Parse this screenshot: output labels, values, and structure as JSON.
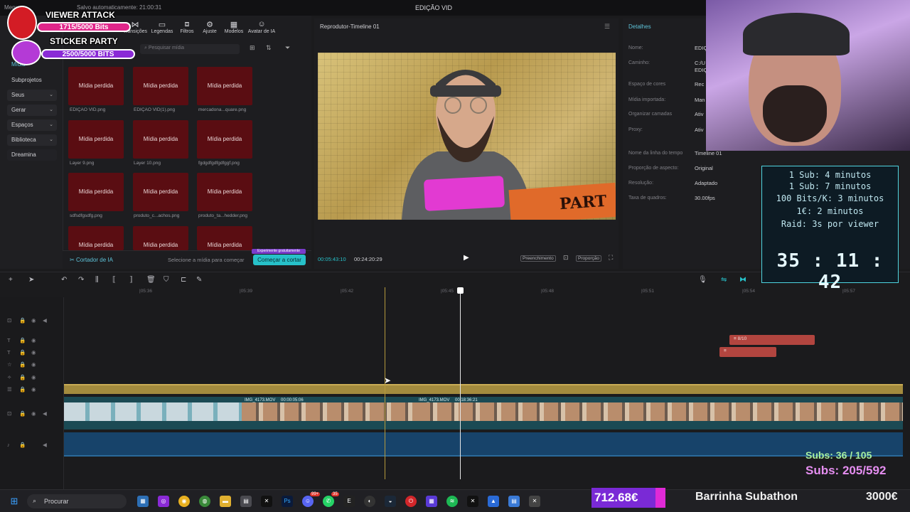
{
  "app": {
    "menu_label": "Menu",
    "autosave": "Salvo automaticamente: 21:00:31",
    "window_title": "EDIÇÃO VID"
  },
  "toolbar": {
    "items": [
      {
        "label": "Transições",
        "icon": "transition-icon"
      },
      {
        "label": "Legendas",
        "icon": "captions-icon"
      },
      {
        "label": "Filtros",
        "icon": "filters-icon"
      },
      {
        "label": "Ajuste",
        "icon": "adjust-icon"
      },
      {
        "label": "Modelos",
        "icon": "templates-icon"
      },
      {
        "label": "Avatar de IA",
        "icon": "avatar-icon"
      }
    ]
  },
  "leftnav": {
    "active": "Mídia",
    "items": [
      "Subprojetos",
      "Seus",
      "Gerar",
      "Espaços",
      "Biblioteca",
      "Dreamina"
    ]
  },
  "media": {
    "search_placeholder": "Pesquisar mídia",
    "items": [
      {
        "label": "Mídia perdida",
        "caption": "EDIÇÃO VID.png"
      },
      {
        "label": "Mídia perdida",
        "caption": "EDIÇÃO VID(1).png"
      },
      {
        "label": "Mídia perdida",
        "caption": "mercadona...quare.png"
      },
      {
        "label": "Mídia perdida",
        "caption": "Layer 9.png"
      },
      {
        "label": "Mídia perdida",
        "caption": "Layer 10.png"
      },
      {
        "label": "Mídia perdida",
        "caption": "fgdgdfgdfgdfggf.png"
      },
      {
        "label": "Mídia perdida",
        "caption": "sdfsdfgsdfg.png"
      },
      {
        "label": "Mídia perdida",
        "caption": "produto_c...achos.png"
      },
      {
        "label": "Mídia perdida",
        "caption": "produto_ta...hedder.png"
      },
      {
        "label": "Mídia perdida",
        "caption": ""
      },
      {
        "label": "Mídia perdida",
        "caption": ""
      },
      {
        "label": "Mídia perdida",
        "caption": ""
      }
    ],
    "footer": {
      "ai_cutter": "Cortador de IA",
      "hint": "Selecione a mídia para começar",
      "trial": "Experimente gratuitamente",
      "button": "Começar a cortar"
    }
  },
  "player": {
    "title": "Reprodutor-Timeline 01",
    "current": "00:05:43:10",
    "total": "00:24:20:29",
    "fill_label": "Preenchimento",
    "ratio_label": "Proporção"
  },
  "details": {
    "title": "Detalhes",
    "rows": [
      {
        "label": "Nome:",
        "value": "EDIÇ"
      },
      {
        "label": "Caminho:",
        "value": "C:/U"
      },
      {
        "label": "",
        "value": "EDIÇ"
      },
      {
        "label": "Espaço de cores",
        "value": "Rec"
      },
      {
        "label": "Mídia importada:",
        "value": "Man"
      },
      {
        "label": "Organizar camadas",
        "value": "Ativ"
      },
      {
        "label": "Proxy:",
        "value": "Ativ"
      },
      {
        "label": "Nome da linha do tempo",
        "value": "Timeline 01"
      },
      {
        "label": "Proporção de aspecto:",
        "value": "Original"
      },
      {
        "label": "Resolução:",
        "value": "Adaptado"
      },
      {
        "label": "Taxa de quadros:",
        "value": "30.00fps"
      }
    ]
  },
  "timeline": {
    "ticks": [
      "|05:36",
      "|05:39",
      "|05:42",
      "|05:45",
      "|05:48",
      "|05:51",
      "|05:54",
      "|05:57"
    ],
    "clips": [
      {
        "name": "IMG_4173.MOV",
        "time": "00:00:05:06"
      },
      {
        "name": "IMG_4173.MOV",
        "time": "00:18:36:21"
      }
    ],
    "red_clips": [
      "8/10",
      ""
    ]
  },
  "taskbar": {
    "search": "Procurar",
    "badge_discord": "99+",
    "badge_whatsapp": "35"
  },
  "overlays": {
    "viewer_attack": "VIEWER ATTACK",
    "viewer_bits": "1715/5000 Bits",
    "viewer_progress": 0.343,
    "sticker_party": "STICKER PARTY",
    "sticker_bits": "2500/5000 BITS",
    "sticker_progress": 0.5,
    "rules": [
      "1 Sub: 4 minutos",
      "1 Sub: 7 minutos",
      "100 Bits/K: 3 minutos",
      "1€: 2 minutos",
      "Raid: 3s por viewer"
    ],
    "clock": "35 : 11 : 42",
    "subs_1": "Subs: 36 / 105",
    "subs_2": "Subs: 205/592",
    "money": "712.68€",
    "subathon": "Barrinha Subathon",
    "goal": "3000€"
  },
  "colors": {
    "accent": "#27c1c9",
    "lost_media": "#5a0d12",
    "clip_red": "#b2453f",
    "audio": "#17436a"
  }
}
